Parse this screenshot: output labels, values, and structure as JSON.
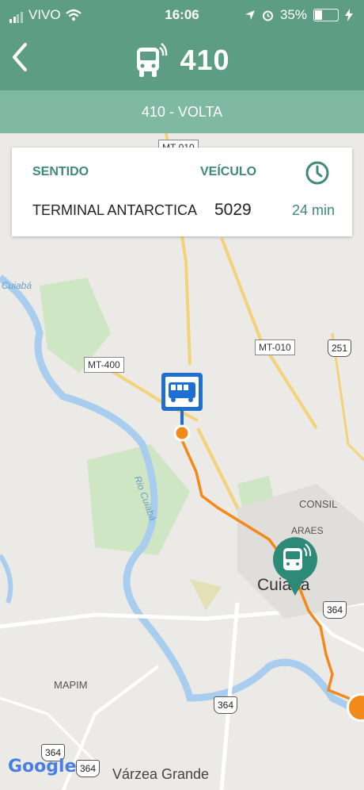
{
  "status_bar": {
    "carrier": "VIVO",
    "time": "16:06",
    "battery_percent": "35%",
    "battery_level": 0.35
  },
  "header": {
    "route_number": "410"
  },
  "subheader": {
    "direction_title": "410 - VOLTA"
  },
  "info_card": {
    "direction_header": "SENTIDO",
    "vehicle_header": "VEÍCULO",
    "direction_value": "TERMINAL ANTARCTICA",
    "vehicle_value": "5029",
    "eta_value": "24 min"
  },
  "map": {
    "road_labels": [
      "MT-010",
      "MT-010",
      "MT-400",
      "251",
      "364",
      "364",
      "364",
      "364"
    ],
    "place_labels": [
      "Cuiabá",
      "Rio Cuiabá",
      "CONSIL",
      "ARAES",
      "Cuiabá",
      "MAPIM",
      "Várzea Grande"
    ],
    "attribution": "Google"
  },
  "colors": {
    "header_bg": "#5e9d85",
    "subheader_bg": "#7fb9a4",
    "accent": "#3f8a74",
    "route_line": "#f28a1a",
    "stop_marker": "#1f6fd1"
  }
}
